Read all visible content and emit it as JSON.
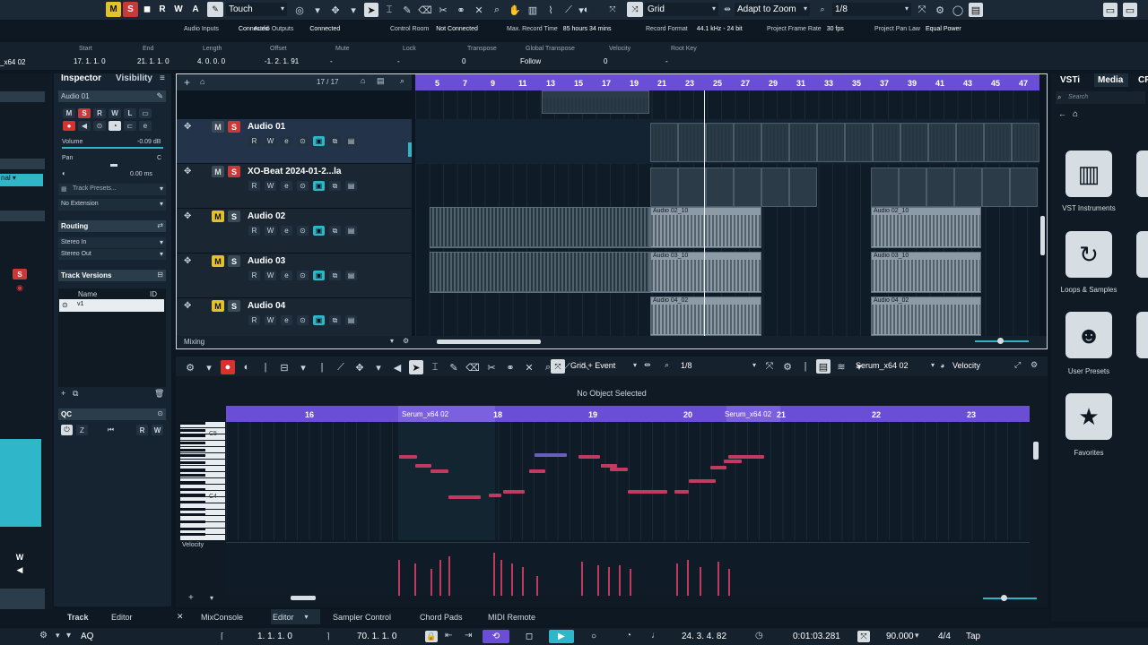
{
  "colors": {
    "accent": "#6a4fd6",
    "record": "#d8322f",
    "mute": "#e2c12c",
    "solo": "#c83a38",
    "selection": "#2fb6c8",
    "note": "#c13a5f",
    "waveform": "#8c9ba5"
  },
  "toolbar": {
    "m_label": "M",
    "s_label": "S",
    "r_label": "R",
    "w_label": "W",
    "a_label": "A",
    "automation_mode": "Touch",
    "snap_type": "Grid",
    "zoom_mode": "Adapt to Zoom",
    "quantize": "1/8"
  },
  "status": {
    "items": [
      {
        "label": "Audio Inputs",
        "value": "Connected"
      },
      {
        "label": "Audio Outputs",
        "value": "Connected"
      },
      {
        "label": "Control Room",
        "value": "Not Connected"
      },
      {
        "label": "Max. Record Time",
        "value": "85 hours 34 mins"
      },
      {
        "label": "Record Format",
        "value": "44.1 kHz - 24 bit"
      },
      {
        "label": "Project Frame Rate",
        "value": "30 fps"
      },
      {
        "label": "Project Pan Law",
        "value": "Equal Power"
      }
    ]
  },
  "infoline": {
    "left_name": "_x64 02",
    "fields": [
      {
        "label": "Start",
        "value": "17. 1. 1. 0"
      },
      {
        "label": "End",
        "value": "21. 1. 1. 0"
      },
      {
        "label": "Length",
        "value": "4. 0. 0. 0"
      },
      {
        "label": "Offset",
        "value": "-1. 2. 1. 91"
      },
      {
        "label": "Mute",
        "value": "-"
      },
      {
        "label": "Lock",
        "value": "-"
      },
      {
        "label": "Transpose",
        "value": "0"
      },
      {
        "label": "Global Transpose",
        "value": "Follow"
      },
      {
        "label": "Velocity",
        "value": "0"
      },
      {
        "label": "Root Key",
        "value": "-"
      }
    ]
  },
  "inspector": {
    "tab_inspector": "Inspector",
    "tab_visibility": "Visibility",
    "track_name": "Audio 01",
    "volume_label": "Volume",
    "volume_value": "-0.09 dB",
    "pan_label": "Pan",
    "pan_value": "C",
    "delay_value": "0.00 ms",
    "preset_label": "Track Presets...",
    "extension": "No Extension",
    "routing": "Routing",
    "routing_in": "Stereo In",
    "routing_out": "Stereo Out",
    "track_versions": "Track Versions",
    "tv_name_col": "Name",
    "tv_id_col": "ID",
    "tv_item": "v1",
    "qc": "QC"
  },
  "tracklist": {
    "count": "17 / 17",
    "tracks": [
      {
        "name": "Audio 01"
      },
      {
        "name": "XO-Beat 2024-01-2...la"
      },
      {
        "name": "Audio 02"
      },
      {
        "name": "Audio 03"
      },
      {
        "name": "Audio 04"
      }
    ],
    "footer": "Mixing"
  },
  "ruler": {
    "bars": [
      "5",
      "7",
      "9",
      "11",
      "13",
      "15",
      "17",
      "19",
      "21",
      "23",
      "25",
      "27",
      "29",
      "31",
      "33",
      "35",
      "37",
      "39",
      "41",
      "43",
      "45",
      "47"
    ]
  },
  "clips": {
    "a02a": "Audio 02_10",
    "a02b": "Audio 02_10",
    "a03a": "Audio 03_10",
    "a03b": "Audio 03_10",
    "a04a": "Audio 04_02",
    "a04b": "Audio 04_02"
  },
  "editor": {
    "snap": "Grid + Event",
    "quantize": "1/8",
    "part_name": "Serum_x64 02",
    "lane": "Velocity",
    "status": "No Object Selected",
    "ruler": [
      "16",
      "18",
      "19",
      "20",
      "21",
      "22",
      "23"
    ],
    "part_label1": "Serum_x64 02",
    "part_label2": "Serum_x64 02",
    "c5": "C5",
    "c4": "C4",
    "velocity_label": "Velocity"
  },
  "bottom_tabs": {
    "track": "Track",
    "editor": "Editor",
    "mixconsole": "MixConsole",
    "editor2": "Editor",
    "sampler": "Sampler Control",
    "chordpads": "Chord Pads",
    "midiremote": "MIDI Remote"
  },
  "transport": {
    "left_locator": "1. 1. 1. 0",
    "right_locator": "70. 1. 1. 0",
    "position": "24. 3. 4. 82",
    "time": "0:01:03.281",
    "tempo": "90.000",
    "signature": "4/4",
    "tap": "Tap",
    "aq": "AQ"
  },
  "mediabay": {
    "tab_vsti": "VSTi",
    "tab_media": "Media",
    "tab_cr": "CR",
    "search": "Search",
    "items": [
      {
        "label": "VST Instruments"
      },
      {
        "label": "Loops & Samples"
      },
      {
        "label": "User Presets"
      },
      {
        "label": "Favorites"
      }
    ]
  }
}
